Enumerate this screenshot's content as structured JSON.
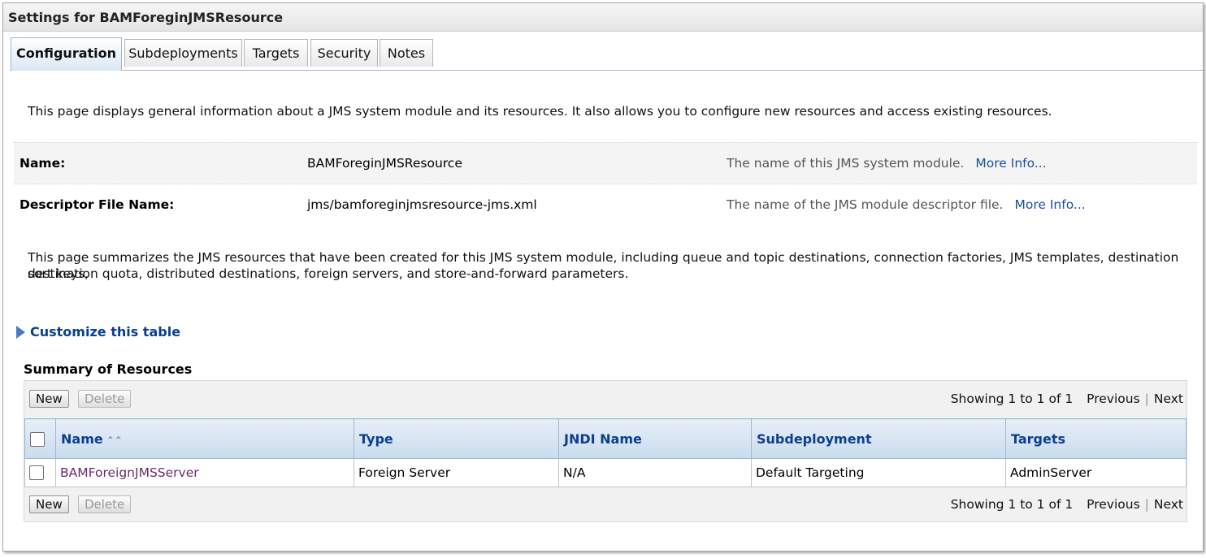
{
  "window": {
    "title": "Settings for BAMForeginJMSResource"
  },
  "tabs": [
    {
      "label": "Configuration",
      "active": true
    },
    {
      "label": "Subdeployments"
    },
    {
      "label": "Targets"
    },
    {
      "label": "Security"
    },
    {
      "label": "Notes"
    }
  ],
  "intro": "This page displays general information about a JMS system module and its resources. It also allows you to configure new resources and access existing resources.",
  "fields": [
    {
      "label": "Name:",
      "value": "BAMForeginJMSResource",
      "help": "The name of this JMS system module.",
      "more": "More Info..."
    },
    {
      "label": "Descriptor File Name:",
      "value": "jms/bamforeginjmsresource-jms.xml",
      "help": "The name of the JMS module descriptor file.",
      "more": "More Info..."
    }
  ],
  "summary_text_1": "This page summarizes the JMS resources that have been created for this JMS system module, including queue and topic destinations, connection factories, JMS templates, destination sort keys,",
  "summary_text_2": "destination quota, distributed destinations, foreign servers, and store-and-forward parameters.",
  "customize": "Customize this table",
  "table": {
    "title": "Summary of Resources",
    "new_label": "New",
    "delete_label": "Delete",
    "showing": "Showing 1 to 1 of 1",
    "previous": "Previous",
    "next": "Next",
    "columns": [
      "Name",
      "Type",
      "JNDI Name",
      "Subdeployment",
      "Targets"
    ],
    "rows": [
      {
        "name": "BAMForeignJMSServer",
        "type": "Foreign Server",
        "jndi": "N/A",
        "subdeployment": "Default Targeting",
        "targets": "AdminServer"
      }
    ]
  },
  "icons": {
    "customize": "expand-triangle-icon",
    "sort": "sort-ascending-icon"
  },
  "colors": {
    "link": "#0b3f8e",
    "visited_link": "#6b2a6b",
    "header_bg": "#c9dbee"
  }
}
